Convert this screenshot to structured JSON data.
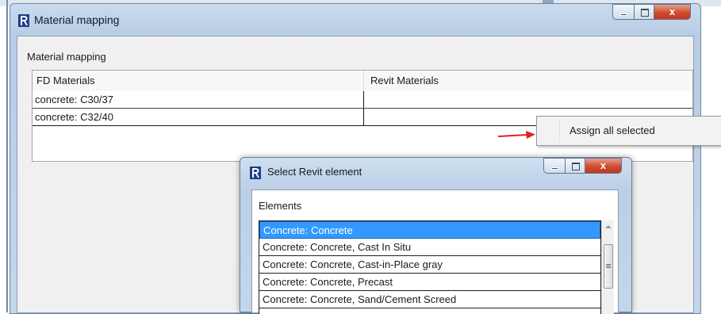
{
  "main_window": {
    "title": "Material mapping",
    "section_label": "Material mapping",
    "columns": [
      "FD Materials",
      "Revit Materials"
    ],
    "rows": [
      {
        "fd": "concrete: C30/37",
        "revit": ""
      },
      {
        "fd": "concrete: C32/40",
        "revit": ""
      }
    ],
    "caption_buttons": {
      "close": "x"
    }
  },
  "context_menu": {
    "items": [
      "Assign all selected"
    ]
  },
  "annotation": {
    "arrow_color": "#e02020"
  },
  "dialog": {
    "title": "Select Revit element",
    "list_header": "Elements",
    "items": [
      "Concrete: Concrete",
      "Concrete: Concrete, Cast In Situ",
      "Concrete: Concrete, Cast-in-Place gray",
      "Concrete: Concrete, Precast",
      "Concrete: Concrete, Sand/Cement Screed"
    ],
    "selected_index": 0,
    "caption_buttons": {
      "close": "x"
    }
  },
  "colors": {
    "selection": "#3399ff",
    "close_button": "#cf4b30",
    "titlebar": "#c9dbee"
  }
}
